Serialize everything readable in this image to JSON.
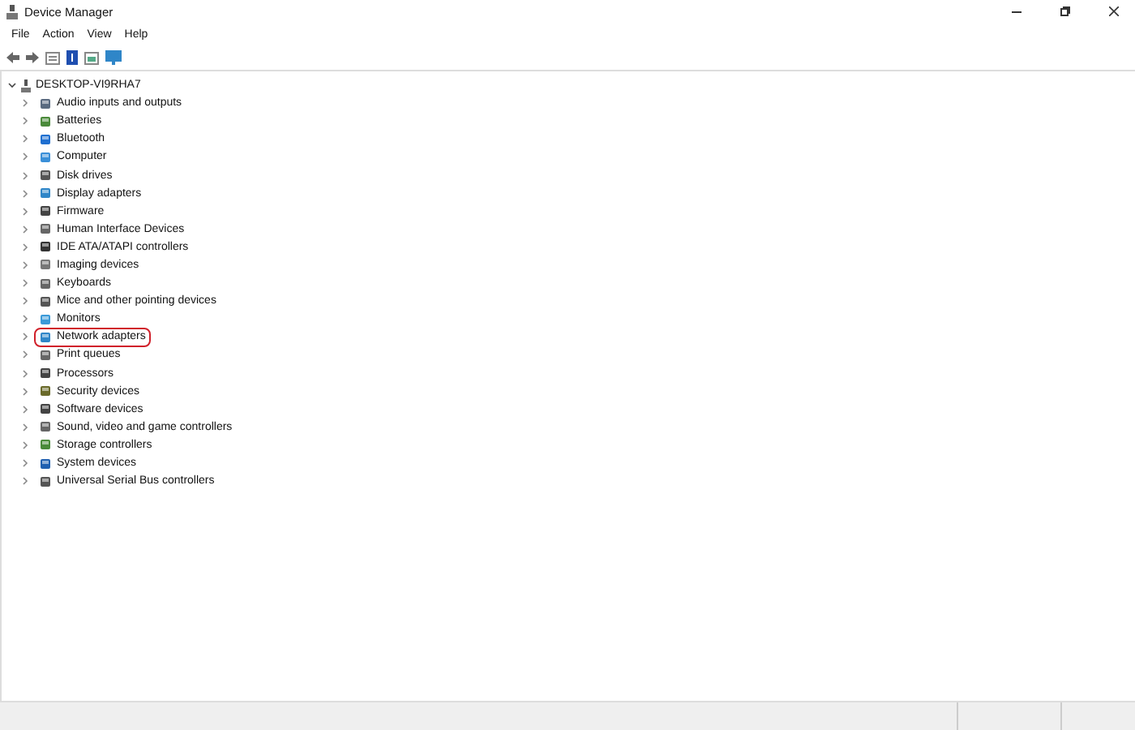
{
  "window": {
    "title": "Device Manager"
  },
  "menu": [
    "File",
    "Action",
    "View",
    "Help"
  ],
  "tree": {
    "label": "DESKTOP-VI9RHA7",
    "expanded": true,
    "children": [
      {
        "label": "Audio inputs and outputs",
        "expanded": false,
        "highlighted": false
      },
      {
        "label": "Batteries",
        "expanded": false,
        "highlighted": false
      },
      {
        "label": "Bluetooth",
        "expanded": false,
        "highlighted": false
      },
      {
        "label": "Computer",
        "expanded": false,
        "highlighted": false
      },
      {
        "label": "Disk drives",
        "expanded": false,
        "highlighted": false
      },
      {
        "label": "Display adapters",
        "expanded": false,
        "highlighted": false
      },
      {
        "label": "Firmware",
        "expanded": false,
        "highlighted": false
      },
      {
        "label": "Human Interface Devices",
        "expanded": false,
        "highlighted": false
      },
      {
        "label": "IDE ATA/ATAPI controllers",
        "expanded": false,
        "highlighted": false
      },
      {
        "label": "Imaging devices",
        "expanded": false,
        "highlighted": false
      },
      {
        "label": "Keyboards",
        "expanded": false,
        "highlighted": false
      },
      {
        "label": "Mice and other pointing devices",
        "expanded": false,
        "highlighted": false
      },
      {
        "label": "Monitors",
        "expanded": false,
        "highlighted": false
      },
      {
        "label": "Network adapters",
        "expanded": false,
        "highlighted": true
      },
      {
        "label": "Print queues",
        "expanded": false,
        "highlighted": false
      },
      {
        "label": "Processors",
        "expanded": false,
        "highlighted": false
      },
      {
        "label": "Security devices",
        "expanded": false,
        "highlighted": false
      },
      {
        "label": "Software devices",
        "expanded": false,
        "highlighted": false
      },
      {
        "label": "Sound, video and game controllers",
        "expanded": false,
        "highlighted": false
      },
      {
        "label": "Storage controllers",
        "expanded": false,
        "highlighted": false
      },
      {
        "label": "System devices",
        "expanded": false,
        "highlighted": false
      },
      {
        "label": "Universal Serial Bus controllers",
        "expanded": false,
        "highlighted": false
      }
    ]
  }
}
